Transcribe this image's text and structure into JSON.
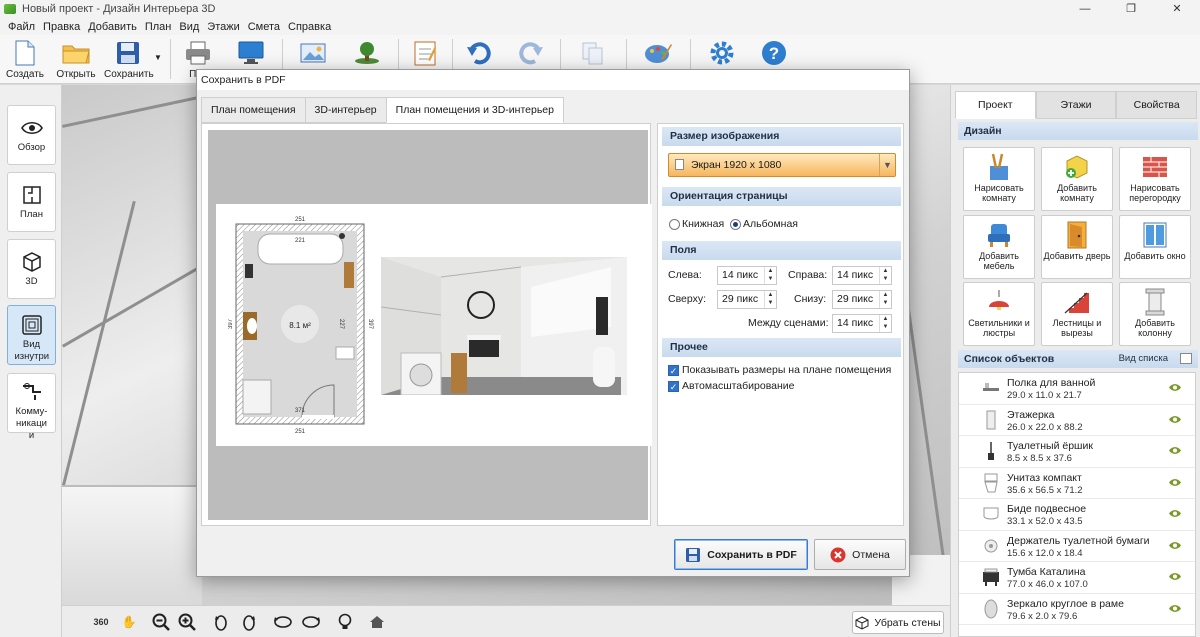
{
  "window": {
    "title": "Новый проект - Дизайн Интерьера 3D",
    "minimize": "—",
    "maximize": "❐",
    "close": "✕"
  },
  "menu": [
    "Файл",
    "Правка",
    "Добавить",
    "План",
    "Вид",
    "Этажи",
    "Смета",
    "Справка"
  ],
  "toolbar": {
    "create": "Создать",
    "open": "Открыть",
    "save": "Сохранить",
    "print": "Печ"
  },
  "leftpanel": [
    {
      "label": "Обзор",
      "icon": "eye-icon"
    },
    {
      "label": "План",
      "icon": "plan-icon"
    },
    {
      "label": "3D",
      "icon": "cube-icon"
    },
    {
      "label": "Вид изнутри",
      "icon": "interior-view-icon",
      "active": true
    },
    {
      "label": "Комму-никации",
      "icon": "pipes-icon"
    }
  ],
  "bottombar": {
    "rotate360": "360",
    "remove_walls": "Убрать стены"
  },
  "rightpanel": {
    "tabs": [
      "Проект",
      "Этажи",
      "Свойства"
    ],
    "design_header": "Дизайн",
    "design_buttons": [
      "Нарисовать комнату",
      "Добавить комнату",
      "Нарисовать перегородку",
      "Добавить мебель",
      "Добавить дверь",
      "Добавить окно",
      "Светильники и люстры",
      "Лестницы и вырезы",
      "Добавить колонну"
    ],
    "objects_header": "Список объектов",
    "list_view": "Вид списка",
    "objects": [
      {
        "name": "Полка для ванной",
        "size": "29.0 x 11.0 x 21.7"
      },
      {
        "name": "Этажерка",
        "size": "26.0 x 22.0 x 88.2"
      },
      {
        "name": "Туалетный ёршик",
        "size": "8.5 x 8.5 x 37.6"
      },
      {
        "name": "Унитаз компакт",
        "size": "35.6 x 56.5 x 71.2"
      },
      {
        "name": "Биде подвесное",
        "size": "33.1 x 52.0 x 43.5"
      },
      {
        "name": "Держатель туалетной бумаги",
        "size": "15.6 x 12.0 x 18.4"
      },
      {
        "name": "Тумба Каталина",
        "size": "77.0 x 46.0 x 107.0"
      },
      {
        "name": "Зеркало круглое в раме",
        "size": "79.6 x 2.0 x 79.6"
      }
    ]
  },
  "dialog": {
    "title": "Сохранить в PDF",
    "tabs": [
      "План помещения",
      "3D-интерьер",
      "План помещения и 3D-интерьер"
    ],
    "plan": {
      "top_dim": "251",
      "inner_dim": "221",
      "left_dim": "397",
      "right_dim": "397",
      "center": "8.1 м²",
      "mid": "227",
      "bottom_inner": "371",
      "bottom_dim": "251"
    },
    "image_size_header": "Размер изображения",
    "image_size": "Экран 1920 x 1080",
    "orientation_header": "Ориентация страницы",
    "portrait": "Книжная",
    "landscape": "Альбомная",
    "margins_header": "Поля",
    "left_label": "Слева:",
    "left_val": "14 пикс",
    "right_label": "Справа:",
    "right_val": "14 пикс",
    "top_label": "Сверху:",
    "top_val": "29 пикс",
    "bottom_label": "Снизу:",
    "bottom_val": "29 пикс",
    "between_label": "Между сценами:",
    "between_val": "14 пикс",
    "other_header": "Прочее",
    "show_dims": "Показывать размеры на плане помещения",
    "autoscale": "Автомасштабирование",
    "save_btn": "Сохранить в PDF",
    "cancel_btn": "Отмена"
  }
}
